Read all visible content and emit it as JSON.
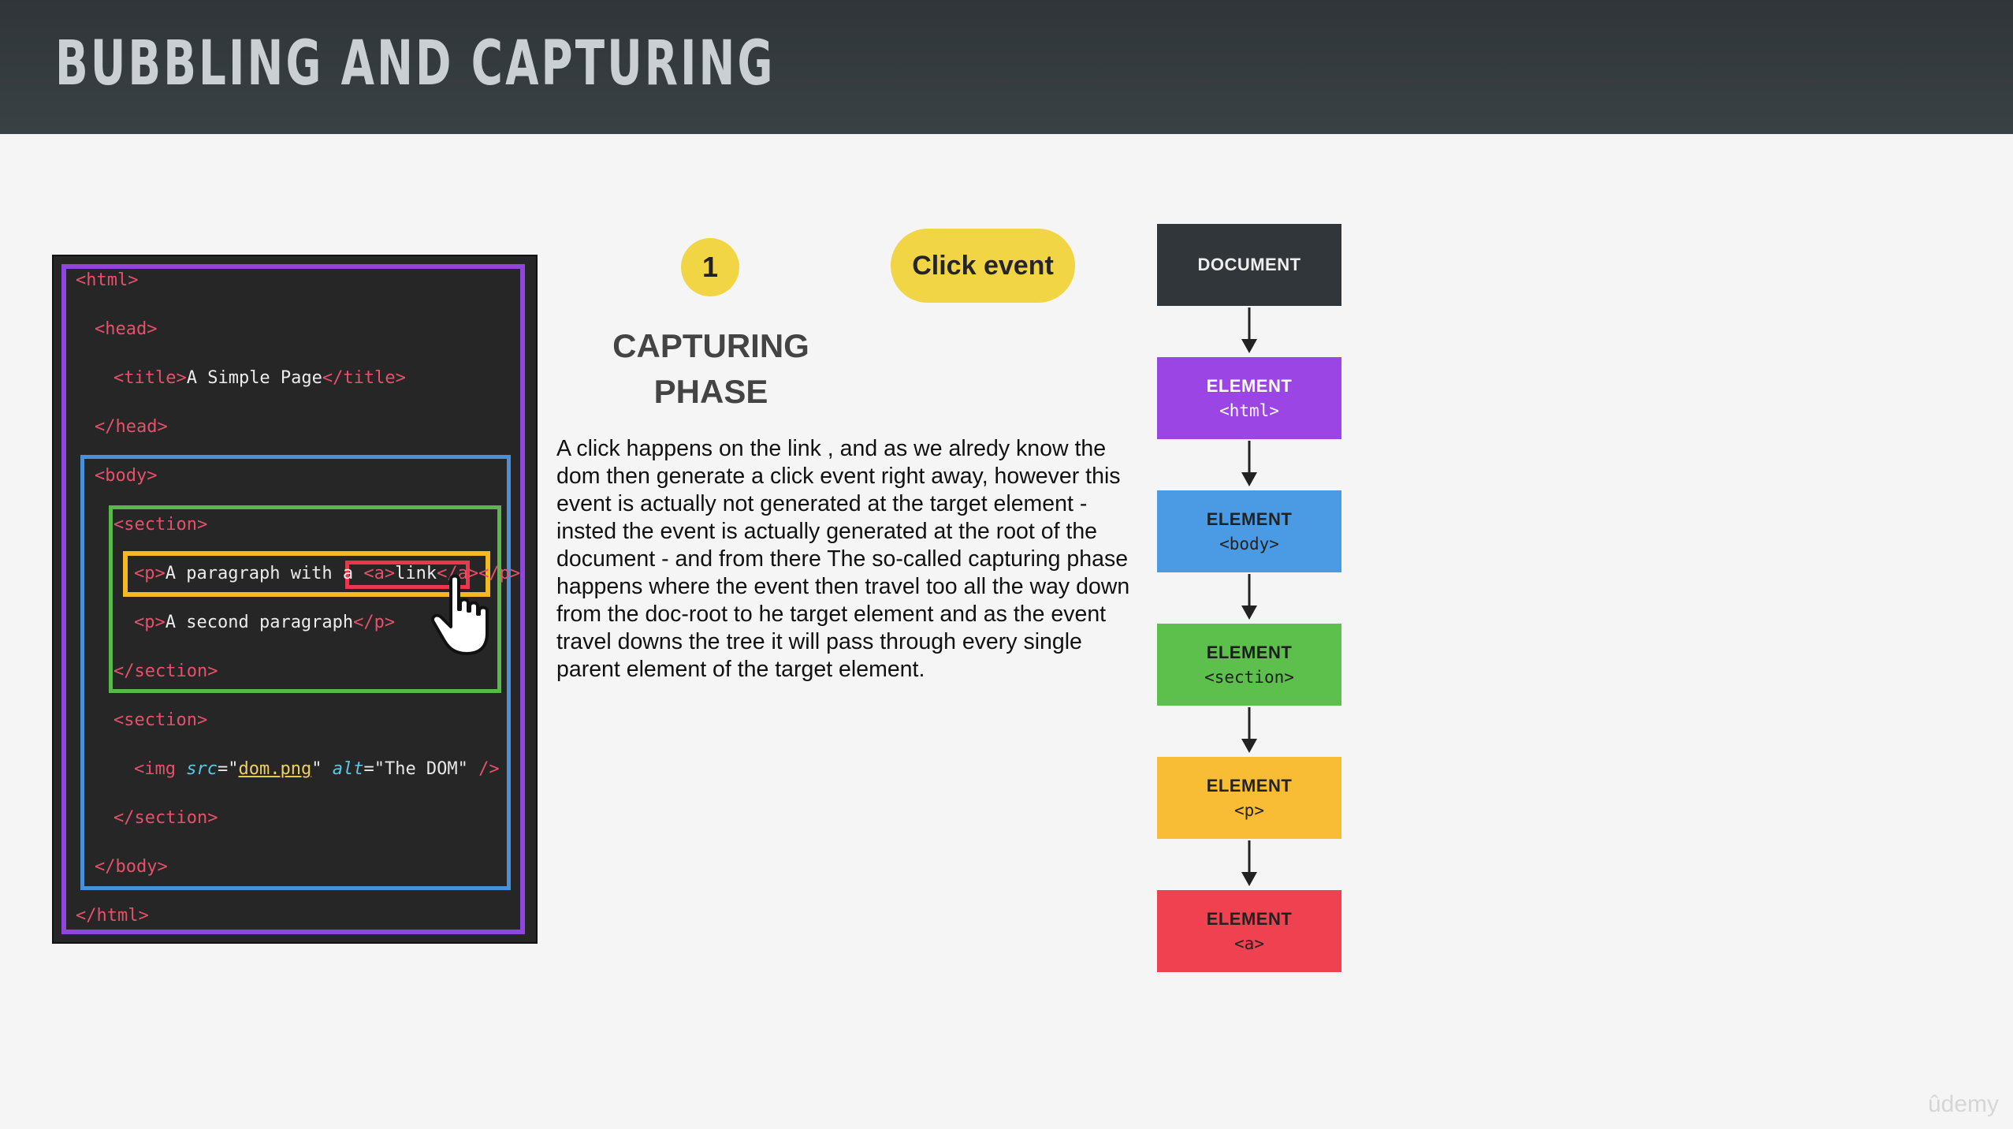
{
  "header": {
    "title": "Bubbling and Capturing"
  },
  "code_panel": {
    "lines": {
      "l1": {
        "open": "<html>"
      },
      "l2": {
        "open": "<head>"
      },
      "l3": {
        "open": "<title>",
        "text": "A Simple Page",
        "close": "</title>"
      },
      "l4": {
        "open": "</head>"
      },
      "l5": {
        "open": "<body>"
      },
      "l6": {
        "open": "<section>"
      },
      "l7": {
        "open": "<p>",
        "text": "A paragraph with a ",
        "a_open": "<a>",
        "a_text": "link",
        "a_close": "</a>",
        "close": "</p>"
      },
      "l8": {
        "open": "<p>",
        "text": "A second paragraph",
        "close": "</p>"
      },
      "l9": {
        "open": "</section>"
      },
      "l10": {
        "open": "<section>"
      },
      "l11": {
        "tag": "<img ",
        "attr1": "src",
        "eq1": "=\"",
        "val1": "dom.png",
        "q1": "\" ",
        "attr2": "alt",
        "eq2": "=\"",
        "val2": "The DOM",
        "q2": "\" ",
        "end": "/>"
      },
      "l12": {
        "open": "</section>"
      },
      "l13": {
        "open": "</body>"
      },
      "l14": {
        "open": "</html>"
      }
    }
  },
  "step": {
    "number": "1"
  },
  "event_pill": {
    "label": "Click event"
  },
  "phase": {
    "line1": "CAPTURING",
    "line2": "PHASE"
  },
  "description": "A click happens on the link , and as we alredy know the dom then generate a click event right away, however this event is actually not generated at the target element - insted the event is actually generated at the root of the document - and from there The so-called capturing phase happens where the event then travel too all the way down from the doc-root to he target element and as the event travel downs the tree it will pass through every single parent element of the target element.",
  "flow": {
    "document": {
      "title": "DOCUMENT"
    },
    "html": {
      "title": "ELEMENT",
      "sub": "<html>"
    },
    "body": {
      "title": "ELEMENT",
      "sub": "<body>"
    },
    "section": {
      "title": "ELEMENT",
      "sub": "<section>"
    },
    "p": {
      "title": "ELEMENT",
      "sub": "<p>"
    },
    "a": {
      "title": "ELEMENT",
      "sub": "<a>"
    }
  },
  "colors": {
    "html": "#9c45e5",
    "body": "#4a9be3",
    "section": "#5dc04d",
    "p": "#f8bd35",
    "a": "#ef4150",
    "document": "#30363a",
    "accent": "#f2d544"
  },
  "icons": {
    "cursor": "hand-pointer-icon",
    "arrow": "arrow-down-icon"
  },
  "watermark": "ûdemy"
}
